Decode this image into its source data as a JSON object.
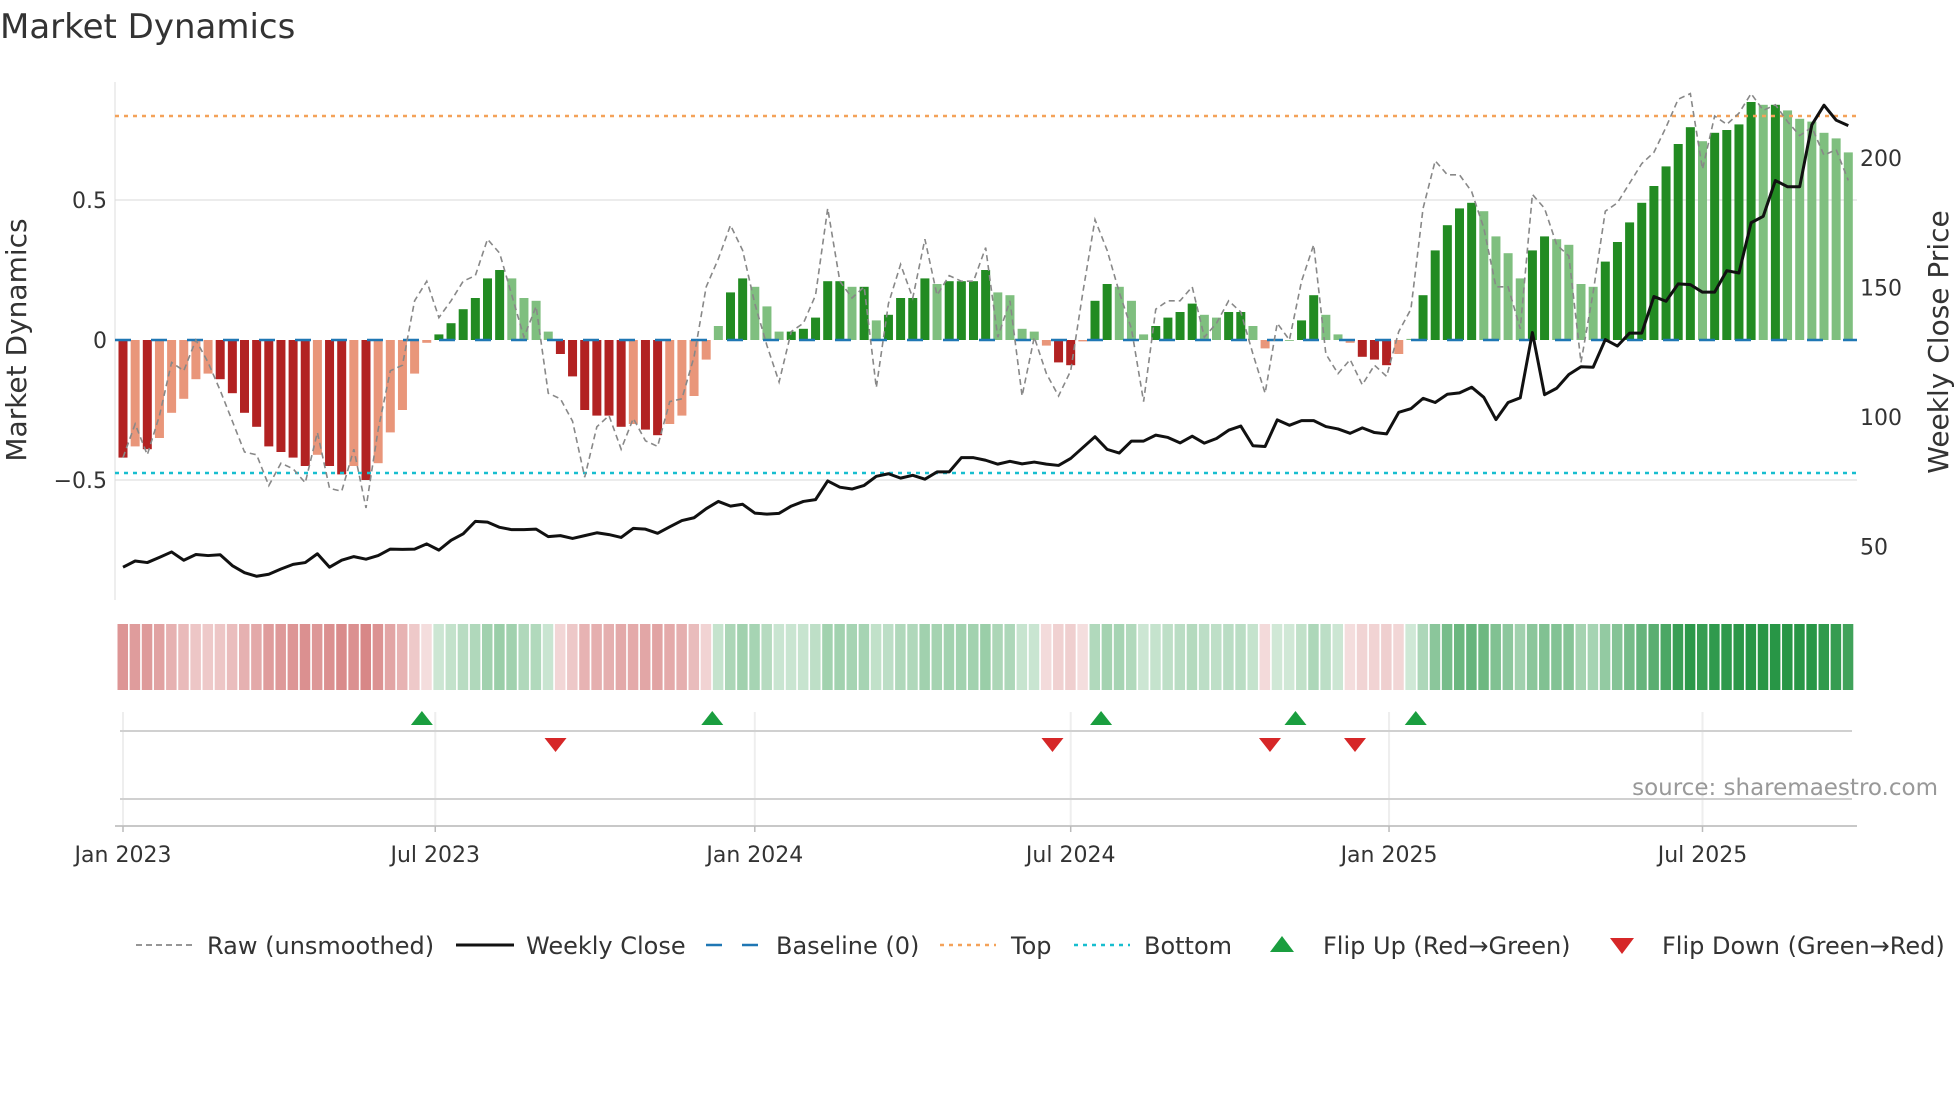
{
  "chart_data": {
    "type": "bar",
    "title": "Market Dynamics",
    "ylabel": "Market Dynamics",
    "y2label": "Weekly Close Price",
    "ylim": [
      -0.75,
      0.93
    ],
    "y2lim": [
      28,
      227
    ],
    "yticks": [
      {
        "v": 0.5,
        "label": "0.5"
      },
      {
        "v": 0,
        "label": "0"
      },
      {
        "v": -0.5,
        "label": "−0.5"
      }
    ],
    "y2ticks": [
      {
        "v": 200,
        "label": "200"
      },
      {
        "v": 150,
        "label": "150"
      },
      {
        "v": 100,
        "label": "100"
      },
      {
        "v": 50,
        "label": "50"
      }
    ],
    "xticks": [
      {
        "week": 0,
        "label": "Jan 2023"
      },
      {
        "week": 25.7,
        "label": "Jul 2023"
      },
      {
        "week": 52,
        "label": "Jan 2024"
      },
      {
        "week": 78,
        "label": "Jul 2024"
      },
      {
        "week": 104.2,
        "label": "Jan 2025"
      },
      {
        "week": 130,
        "label": "Jul 2025"
      }
    ],
    "top": 0.8,
    "bottom": -0.475,
    "baseline": 0,
    "smoothed": [
      -0.42,
      -0.38,
      -0.39,
      -0.35,
      -0.26,
      -0.21,
      -0.14,
      -0.12,
      -0.14,
      -0.19,
      -0.26,
      -0.31,
      -0.38,
      -0.4,
      -0.42,
      -0.45,
      -0.41,
      -0.45,
      -0.48,
      -0.45,
      -0.5,
      -0.44,
      -0.33,
      -0.25,
      -0.12,
      -0.01,
      0.02,
      0.06,
      0.11,
      0.15,
      0.22,
      0.25,
      0.22,
      0.15,
      0.14,
      0.03,
      -0.05,
      -0.13,
      -0.25,
      -0.27,
      -0.27,
      -0.31,
      -0.3,
      -0.32,
      -0.34,
      -0.3,
      -0.27,
      -0.2,
      -0.07,
      0.05,
      0.17,
      0.22,
      0.19,
      0.12,
      0.03,
      0.03,
      0.04,
      0.08,
      0.21,
      0.21,
      0.19,
      0.19,
      0.07,
      0.09,
      0.15,
      0.15,
      0.22,
      0.2,
      0.21,
      0.21,
      0.21,
      0.25,
      0.17,
      0.16,
      0.04,
      0.03,
      -0.02,
      -0.08,
      -0.09,
      -0.005,
      0.14,
      0.2,
      0.19,
      0.14,
      0.02,
      0.05,
      0.08,
      0.1,
      0.13,
      0.09,
      0.08,
      0.1,
      0.1,
      0.05,
      -0.03,
      0.0,
      0.0,
      0.07,
      0.16,
      0.09,
      0.02,
      -0.01,
      -0.06,
      -0.07,
      -0.09,
      -0.05,
      0.004,
      0.16,
      0.32,
      0.41,
      0.47,
      0.49,
      0.46,
      0.37,
      0.31,
      0.22,
      0.32,
      0.37,
      0.36,
      0.34,
      0.2,
      0.19,
      0.28,
      0.35,
      0.42,
      0.49,
      0.55,
      0.62,
      0.7,
      0.76,
      0.71,
      0.74,
      0.75,
      0.77,
      0.85,
      0.84,
      0.84,
      0.82,
      0.79,
      0.78,
      0.74,
      0.72,
      0.67
    ],
    "raw": [
      -0.42,
      -0.3,
      -0.41,
      -0.27,
      -0.08,
      -0.11,
      0.0,
      -0.08,
      -0.18,
      -0.29,
      -0.4,
      -0.41,
      -0.52,
      -0.44,
      -0.46,
      -0.51,
      -0.33,
      -0.53,
      -0.54,
      -0.39,
      -0.6,
      -0.32,
      -0.11,
      -0.09,
      0.14,
      0.21,
      0.08,
      0.14,
      0.21,
      0.23,
      0.36,
      0.31,
      0.16,
      0.01,
      0.12,
      -0.19,
      -0.21,
      -0.29,
      -0.49,
      -0.31,
      -0.27,
      -0.39,
      -0.28,
      -0.36,
      -0.38,
      -0.22,
      -0.21,
      -0.06,
      0.19,
      0.29,
      0.41,
      0.32,
      0.13,
      -0.02,
      -0.15,
      0.03,
      0.06,
      0.16,
      0.47,
      0.21,
      0.15,
      0.19,
      -0.17,
      0.13,
      0.27,
      0.15,
      0.36,
      0.16,
      0.23,
      0.21,
      0.21,
      0.33,
      0.01,
      0.14,
      -0.2,
      0.01,
      -0.12,
      -0.2,
      -0.11,
      0.17,
      0.43,
      0.32,
      0.17,
      0.04,
      -0.22,
      0.11,
      0.14,
      0.14,
      0.19,
      0.01,
      0.06,
      0.14,
      0.1,
      -0.05,
      -0.19,
      0.06,
      0.0,
      0.21,
      0.34,
      -0.05,
      -0.12,
      -0.07,
      -0.16,
      -0.09,
      -0.13,
      0.03,
      0.11,
      0.47,
      0.64,
      0.59,
      0.59,
      0.53,
      0.4,
      0.19,
      0.19,
      0.04,
      0.52,
      0.47,
      0.34,
      0.3,
      -0.08,
      0.17,
      0.46,
      0.49,
      0.56,
      0.63,
      0.67,
      0.76,
      0.86,
      0.88,
      0.61,
      0.8,
      0.77,
      0.81,
      0.88,
      0.82,
      0.84,
      0.78,
      0.73,
      0.76,
      0.66,
      0.68,
      0.57
    ],
    "close": [
      42,
      44.4,
      43.8,
      45.8,
      47.9,
      44.7,
      46.9,
      46.5,
      46.8,
      42.6,
      39.9,
      38.5,
      39.3,
      41.3,
      43.1,
      43.8,
      47.2,
      42,
      44.7,
      46.1,
      45.1,
      46.5,
      49,
      48.9,
      49,
      51,
      48.6,
      52.4,
      54.9,
      59.7,
      59.4,
      57.4,
      56.5,
      56.5,
      56.7,
      53.8,
      54.2,
      53.1,
      54.2,
      55.3,
      54.6,
      53.5,
      57,
      56.7,
      55.1,
      57.6,
      60,
      61.1,
      64.6,
      67.4,
      65.6,
      66.3,
      62.9,
      62.5,
      62.8,
      65.6,
      67.4,
      68.1,
      75.3,
      72.9,
      72.2,
      73.6,
      77.1,
      78.1,
      76.4,
      77.5,
      76,
      78.8,
      78.8,
      84.3,
      84.3,
      83.3,
      81.8,
      82.9,
      81.9,
      82.6,
      81.8,
      81.3,
      84,
      88.2,
      92.4,
      87.5,
      86.1,
      90.7,
      90.7,
      93,
      92.1,
      90,
      92.6,
      89.9,
      91.7,
      94.9,
      96.5,
      88.9,
      88.6,
      98.9,
      96.8,
      98.6,
      98.6,
      96.3,
      95.4,
      93.7,
      95.8,
      94,
      93.5,
      101.8,
      103.2,
      107.2,
      105.6,
      108.8,
      109.3,
      111.5,
      107.6,
      99,
      105.6,
      107.4,
      132.6,
      108.6,
      111.1,
      116.4,
      119.4,
      119.2,
      129.9,
      127.4,
      132.4,
      132.4,
      146.5,
      144.7,
      151.4,
      151.1,
      148.2,
      148.2,
      156.5,
      155.6,
      175,
      177.5,
      191.3,
      188.9,
      188.9,
      212.8,
      220.4,
      214.6,
      212.5
    ],
    "flip_up_weeks": [
      24.6,
      48.5,
      80.5,
      96.5,
      106.4
    ],
    "flip_down_weeks": [
      35.6,
      76.5,
      94.4,
      101.4
    ],
    "legend": [
      {
        "key": "raw",
        "label": "Raw (unsmoothed)"
      },
      {
        "key": "close",
        "label": "Weekly Close"
      },
      {
        "key": "baseline",
        "label": "Baseline (0)"
      },
      {
        "key": "top",
        "label": "Top"
      },
      {
        "key": "bottom",
        "label": "Bottom"
      },
      {
        "key": "flip_up",
        "label": "Flip Up (Red→Green)"
      },
      {
        "key": "flip_down",
        "label": "Flip Down (Green→Red)"
      }
    ],
    "legend_placement": "bottom",
    "source": "source: sharemaestro.com",
    "colors": {
      "pos_strong": "#228b22",
      "pos_weak": "#7fbf7f",
      "neg_strong": "#b22222",
      "neg_weak": "#e9967a",
      "close": "#111111",
      "raw": "#888888",
      "baseline": "#1f77b4",
      "top": "#f4a259",
      "bottom": "#17becf",
      "flip_up": "#1a9e3f",
      "flip_down": "#d62728"
    }
  }
}
